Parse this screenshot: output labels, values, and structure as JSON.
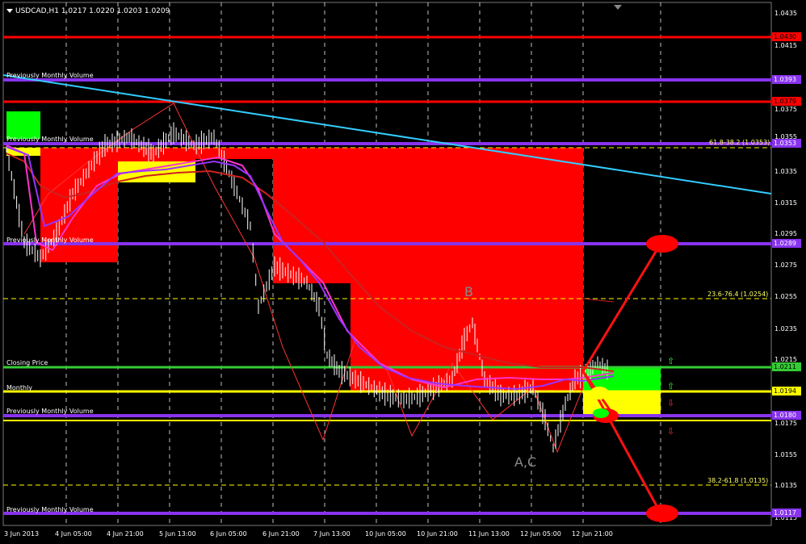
{
  "window": {
    "title": "USDCAD,H1  1.0217 1.0220 1.0203 1.0209"
  },
  "colors": {
    "background": "#000000",
    "grid": "#ffffff",
    "resistance": "#ff0000",
    "monthly_volume": "#8833ee",
    "trendline": "#33ccff",
    "moving_avg_fast": "#ff33cc",
    "moving_avg_slow": "#9933ff",
    "zone_red": "#ff0000",
    "zone_yellow": "#ffff00",
    "zone_green": "#00ff00",
    "closing_price": "#33cc33",
    "monthly": "#ffff00"
  },
  "price_axis": {
    "ticks": [
      "1.0435",
      "1.0415",
      "1.0375",
      "1.0355",
      "1.0335",
      "1.0315",
      "1.0295",
      "1.0275",
      "1.0255",
      "1.0235",
      "1.0215",
      "1.0175",
      "1.0155",
      "1.0135",
      "1.0115"
    ]
  },
  "price_labels": [
    {
      "text": "1.0430",
      "kind": "red"
    },
    {
      "text": "1.0393",
      "kind": "purple"
    },
    {
      "text": "1.0379",
      "kind": "red"
    },
    {
      "text": "1.0353",
      "kind": "purple"
    },
    {
      "text": "1.0289",
      "kind": "purple"
    },
    {
      "text": "1.0211",
      "kind": "green"
    },
    {
      "text": "1.0194",
      "kind": "yellow"
    },
    {
      "text": "1.0180",
      "kind": "purple"
    },
    {
      "text": "1.0117",
      "kind": "purple"
    }
  ],
  "time_axis": {
    "ticks": [
      "3 Jun 2013",
      "4 Jun 05:00",
      "4 Jun 21:00",
      "5 Jun 13:00",
      "6 Jun 05:00",
      "6 Jun 21:00",
      "7 Jun 13:00",
      "10 Jun 05:00",
      "10 Jun 21:00",
      "11 Jun 13:00",
      "12 Jun 05:00",
      "12 Jun 21:00"
    ]
  },
  "line_labels": {
    "pmv_1": "Previously Monthly Volume",
    "pmv_2": "Previously Monthly Volume",
    "pmv_3": "Previously Monthly Volume",
    "pmv_4": "Previously Monthly Volume",
    "pmv_5": "Previously Monthly Volume",
    "closing_price": "Closing Price",
    "monthly": "Monthly"
  },
  "fib_labels": {
    "fib_top": "61.8-38.2 (1.0353)",
    "fib_mid": "23.6-76.4 (1.0254)",
    "fib_low": "38.2-61.8 (1.0135)"
  },
  "wave_labels": {
    "b": "B",
    "ac": "A,C"
  },
  "chart_data": {
    "type": "candlestick",
    "title": "USDCAD,H1",
    "ohlc": {
      "open": 1.0217,
      "high": 1.022,
      "low": 1.0203,
      "close": 1.0209
    },
    "ylim": [
      1.0105,
      1.0445
    ],
    "grid": true,
    "horizontal_levels": [
      {
        "price": 1.043,
        "kind": "resistance"
      },
      {
        "price": 1.0393,
        "kind": "monthly_volume"
      },
      {
        "price": 1.0379,
        "kind": "resistance"
      },
      {
        "price": 1.0353,
        "kind": "monthly_volume"
      },
      {
        "price": 1.0289,
        "kind": "monthly_volume"
      },
      {
        "price": 1.0254,
        "kind": "fibonacci"
      },
      {
        "price": 1.0211,
        "kind": "closing_price"
      },
      {
        "price": 1.0194,
        "kind": "monthly"
      },
      {
        "price": 1.018,
        "kind": "monthly_volume"
      },
      {
        "price": 1.0135,
        "kind": "fibonacci"
      },
      {
        "price": 1.0117,
        "kind": "monthly_volume"
      }
    ]
  }
}
